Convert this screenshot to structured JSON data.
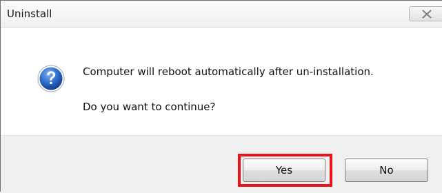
{
  "window": {
    "title": "Uninstall",
    "close_icon": "close-icon"
  },
  "message": {
    "icon": "question-icon",
    "line1": "Computer will reboot automatically after un-installation.",
    "line2": "Do you want to continue?"
  },
  "buttons": {
    "yes_label": "Yes",
    "no_label": "No"
  },
  "annotation": {
    "highlight_color": "#e8141c"
  }
}
